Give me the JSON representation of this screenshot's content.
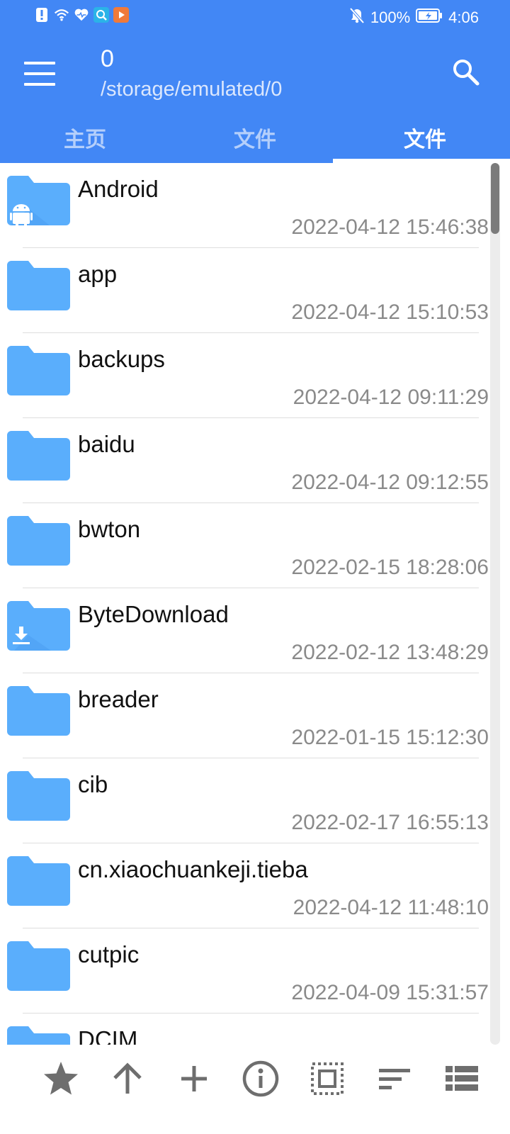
{
  "status_bar": {
    "battery": "100%",
    "time": "4:06",
    "icons": [
      "alert-icon",
      "wifi-icon",
      "heart-icon",
      "search-app-icon",
      "video-app-icon",
      "mute-icon",
      "battery-icon"
    ]
  },
  "header": {
    "title": "0",
    "path": "/storage/emulated/0",
    "menu_icon": "hamburger-menu-icon",
    "search_icon": "search-icon"
  },
  "tabs": [
    {
      "label": "主页",
      "active": false
    },
    {
      "label": "文件",
      "active": false
    },
    {
      "label": "文件",
      "active": true
    }
  ],
  "files": [
    {
      "name": "Android",
      "date": "2022-04-12 15:46:38",
      "icon": "android-folder-icon"
    },
    {
      "name": "app",
      "date": "2022-04-12 15:10:53",
      "icon": "folder-icon"
    },
    {
      "name": "backups",
      "date": "2022-04-12 09:11:29",
      "icon": "folder-icon"
    },
    {
      "name": "baidu",
      "date": "2022-04-12 09:12:55",
      "icon": "folder-icon"
    },
    {
      "name": "bwton",
      "date": "2022-02-15 18:28:06",
      "icon": "folder-icon"
    },
    {
      "name": "ByteDownload",
      "date": "2022-02-12 13:48:29",
      "icon": "download-folder-icon"
    },
    {
      "name": "breader",
      "date": "2022-01-15 15:12:30",
      "icon": "folder-icon"
    },
    {
      "name": "cib",
      "date": "2022-02-17 16:55:13",
      "icon": "folder-icon"
    },
    {
      "name": "cn.xiaochuankeji.tieba",
      "date": "2022-04-12 11:48:10",
      "icon": "folder-icon"
    },
    {
      "name": "cutpic",
      "date": "2022-04-09 15:31:57",
      "icon": "folder-icon"
    },
    {
      "name": "DCIM",
      "date": "",
      "icon": "folder-icon"
    }
  ],
  "bottom_bar": [
    "star-icon",
    "arrow-up-icon",
    "plus-icon",
    "info-icon",
    "select-all-icon",
    "sort-icon",
    "list-view-icon"
  ],
  "colors": {
    "accent": "#4287f5",
    "folder": "#5aaefc",
    "date_text": "#8a8a8a"
  }
}
